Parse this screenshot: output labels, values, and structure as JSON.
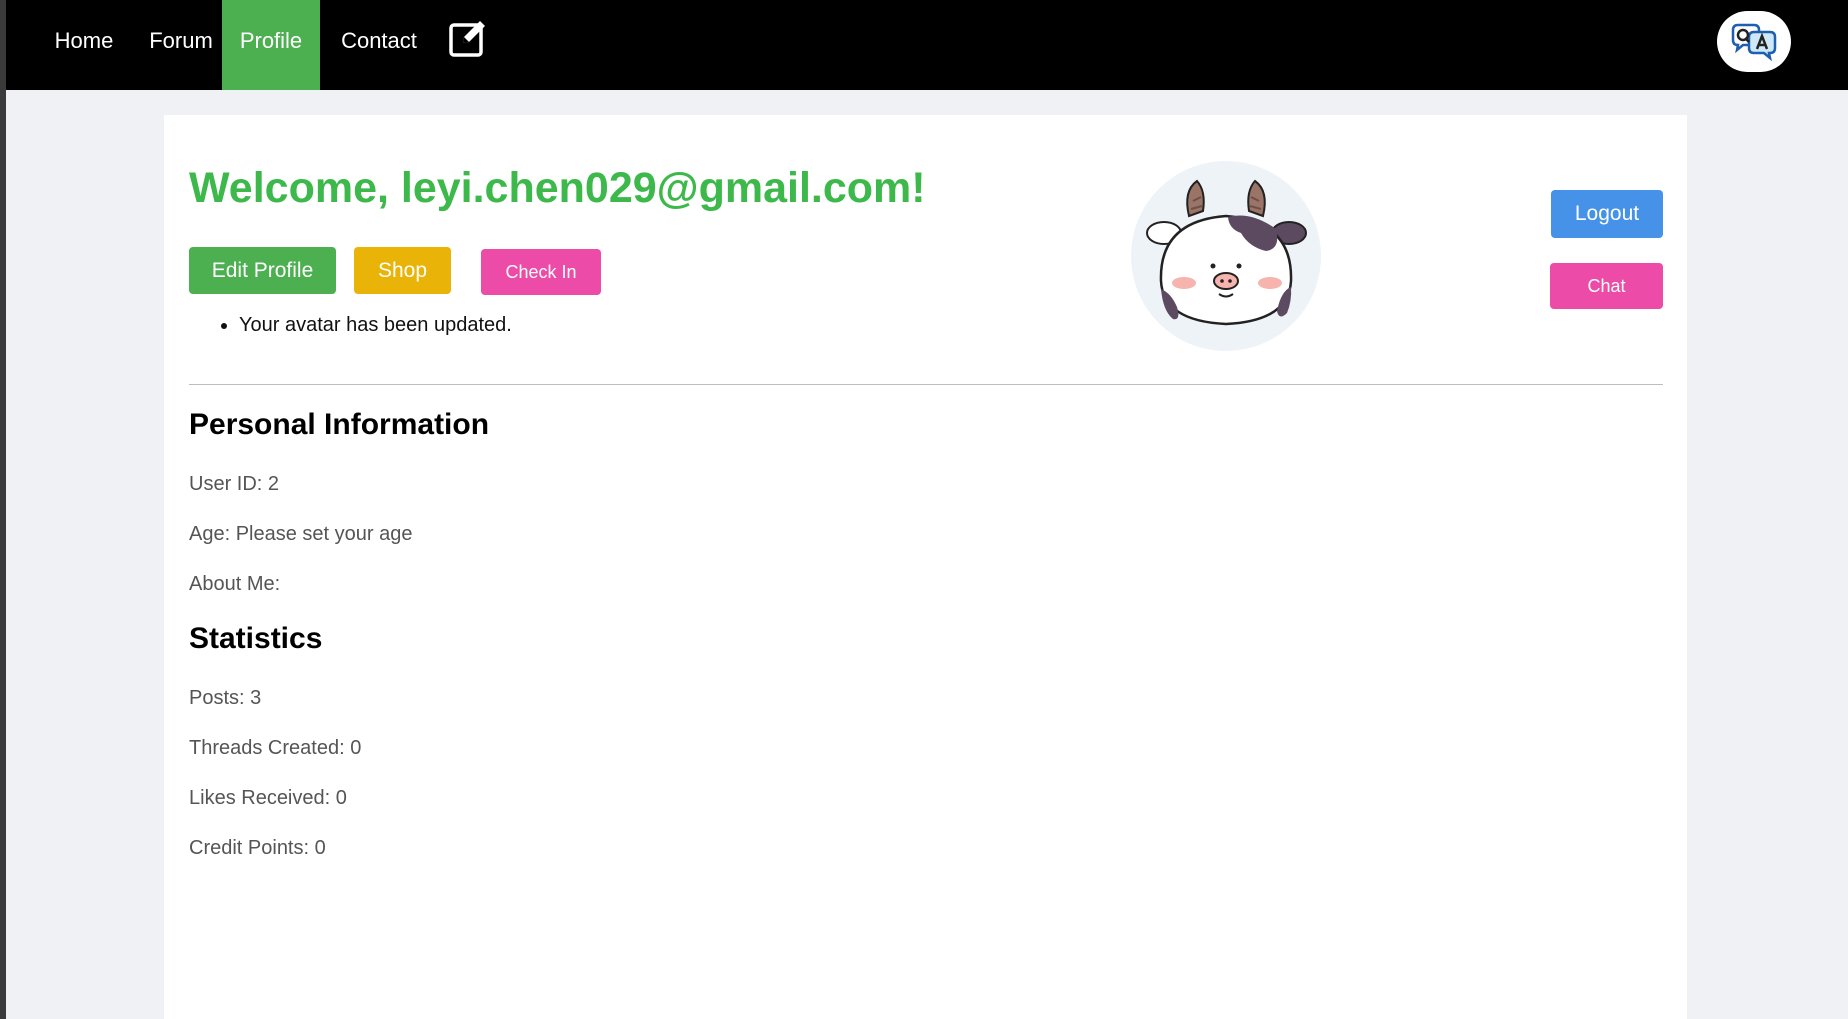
{
  "nav": {
    "items": [
      {
        "label": "Home"
      },
      {
        "label": "Forum"
      },
      {
        "label": "Profile"
      },
      {
        "label": "Contact"
      }
    ],
    "active": "Profile",
    "edit_icon": "edit-note-icon",
    "logo_icon": "qa-chat-logo-icon"
  },
  "header": {
    "welcome": "Welcome, leyi.chen029@gmail.com!"
  },
  "actions": {
    "edit_profile": "Edit Profile",
    "shop": "Shop",
    "check_in": "Check In",
    "logout": "Logout",
    "chat": "Chat"
  },
  "messages": [
    "Your avatar has been updated."
  ],
  "avatar": {
    "icon": "cow-avatar-icon"
  },
  "personal": {
    "title": "Personal Information",
    "user_id": "User ID: 2",
    "age": "Age: Please set your age",
    "about": "About Me:"
  },
  "stats": {
    "title": "Statistics",
    "posts": "Posts: 3",
    "threads": "Threads Created: 0",
    "likes": "Likes Received: 0",
    "credits": "Credit Points: 0"
  },
  "colors": {
    "accent_green": "#4caf50",
    "welcome_green": "#3db84b",
    "shop_yellow": "#eab308",
    "pink": "#ec4ba8",
    "logout_blue": "#4592e8"
  }
}
